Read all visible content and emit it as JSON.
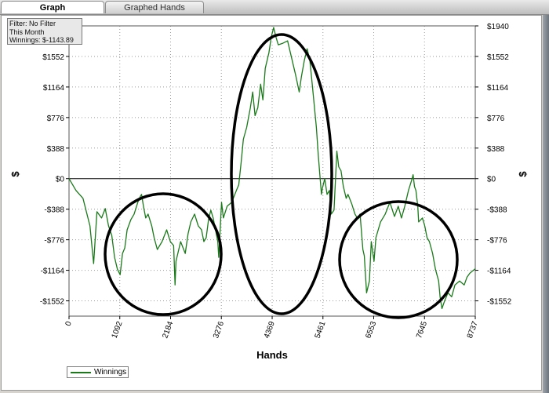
{
  "tabs": [
    {
      "label": "Graph",
      "active": true
    },
    {
      "label": "Graphed Hands",
      "active": false
    }
  ],
  "filter": {
    "line1": "Filter: No Filter",
    "line2": "This Month",
    "line3": "Winnings: $-1143.89"
  },
  "chart_data": {
    "type": "line",
    "xlabel": "Hands",
    "ylabel": "$",
    "xlim": [
      0,
      8737
    ],
    "ylim": [
      -1746,
      1940
    ],
    "x_ticks": [
      "0",
      "1092",
      "2184",
      "3276",
      "4369",
      "5461",
      "6553",
      "7645",
      "8737"
    ],
    "y_ticks_left": [
      "$1552",
      "$1164",
      "$776",
      "$388",
      "$0",
      "-$388",
      "-$776",
      "-$1164",
      "-$1552"
    ],
    "y_ticks_right": [
      "$1940",
      "$1552",
      "$1164",
      "$776",
      "$388",
      "$0",
      "-$388",
      "-$776",
      "-$1164",
      "-$1552"
    ],
    "grid": true,
    "legend_position": "bottom-left",
    "series": [
      {
        "name": "Winnings",
        "color": "#1a7a1a",
        "points": [
          [
            0,
            0
          ],
          [
            150,
            -150
          ],
          [
            300,
            -250
          ],
          [
            450,
            -600
          ],
          [
            530,
            -1080
          ],
          [
            600,
            -420
          ],
          [
            700,
            -500
          ],
          [
            780,
            -380
          ],
          [
            850,
            -600
          ],
          [
            920,
            -720
          ],
          [
            980,
            -1000
          ],
          [
            1040,
            -1150
          ],
          [
            1100,
            -1220
          ],
          [
            1150,
            -950
          ],
          [
            1200,
            -880
          ],
          [
            1250,
            -650
          ],
          [
            1330,
            -520
          ],
          [
            1400,
            -450
          ],
          [
            1480,
            -300
          ],
          [
            1530,
            -230
          ],
          [
            1560,
            -200
          ],
          [
            1600,
            -350
          ],
          [
            1650,
            -500
          ],
          [
            1700,
            -450
          ],
          [
            1780,
            -600
          ],
          [
            1830,
            -750
          ],
          [
            1900,
            -900
          ],
          [
            2000,
            -800
          ],
          [
            2100,
            -650
          ],
          [
            2180,
            -800
          ],
          [
            2250,
            -850
          ],
          [
            2280,
            -1350
          ],
          [
            2300,
            -1050
          ],
          [
            2400,
            -800
          ],
          [
            2500,
            -950
          ],
          [
            2560,
            -700
          ],
          [
            2620,
            -550
          ],
          [
            2700,
            -450
          ],
          [
            2780,
            -600
          ],
          [
            2850,
            -650
          ],
          [
            2900,
            -800
          ],
          [
            2950,
            -750
          ],
          [
            3000,
            -520
          ],
          [
            3050,
            -400
          ],
          [
            3100,
            -500
          ],
          [
            3150,
            -650
          ],
          [
            3200,
            -800
          ],
          [
            3220,
            -1000
          ],
          [
            3280,
            -300
          ],
          [
            3320,
            -500
          ],
          [
            3400,
            -350
          ],
          [
            3500,
            -300
          ],
          [
            3600,
            -150
          ],
          [
            3650,
            -80
          ],
          [
            3700,
            200
          ],
          [
            3750,
            500
          ],
          [
            3820,
            650
          ],
          [
            3900,
            900
          ],
          [
            3950,
            1100
          ],
          [
            4000,
            800
          ],
          [
            4060,
            900
          ],
          [
            4120,
            1200
          ],
          [
            4170,
            1000
          ],
          [
            4220,
            1400
          ],
          [
            4300,
            1600
          ],
          [
            4350,
            1800
          ],
          [
            4400,
            1920
          ],
          [
            4450,
            1800
          ],
          [
            4500,
            1700
          ],
          [
            4600,
            1720
          ],
          [
            4700,
            1750
          ],
          [
            4800,
            1500
          ],
          [
            4880,
            1300
          ],
          [
            4950,
            1100
          ],
          [
            5000,
            1300
          ],
          [
            5060,
            1500
          ],
          [
            5120,
            1650
          ],
          [
            5180,
            1500
          ],
          [
            5230,
            1200
          ],
          [
            5280,
            900
          ],
          [
            5320,
            650
          ],
          [
            5360,
            300
          ],
          [
            5400,
            0
          ],
          [
            5430,
            -200
          ],
          [
            5450,
            -120
          ],
          [
            5500,
            0
          ],
          [
            5550,
            -200
          ],
          [
            5600,
            -150
          ],
          [
            5640,
            -450
          ],
          [
            5700,
            -400
          ],
          [
            5760,
            350
          ],
          [
            5800,
            150
          ],
          [
            5850,
            100
          ],
          [
            5900,
            -100
          ],
          [
            5960,
            -250
          ],
          [
            6000,
            -200
          ],
          [
            6080,
            -320
          ],
          [
            6150,
            -450
          ],
          [
            6200,
            -500
          ],
          [
            6260,
            -450
          ],
          [
            6300,
            -750
          ],
          [
            6320,
            -900
          ],
          [
            6350,
            -980
          ],
          [
            6400,
            -1450
          ],
          [
            6460,
            -1300
          ],
          [
            6500,
            -800
          ],
          [
            6560,
            -1050
          ],
          [
            6600,
            -750
          ],
          [
            6700,
            -550
          ],
          [
            6800,
            -450
          ],
          [
            6900,
            -300
          ],
          [
            7000,
            -480
          ],
          [
            7080,
            -350
          ],
          [
            7150,
            -500
          ],
          [
            7220,
            -350
          ],
          [
            7300,
            -150
          ],
          [
            7380,
            0
          ],
          [
            7400,
            50
          ],
          [
            7430,
            -100
          ],
          [
            7460,
            -150
          ],
          [
            7500,
            -350
          ],
          [
            7520,
            -550
          ],
          [
            7600,
            -500
          ],
          [
            7650,
            -600
          ],
          [
            7700,
            -750
          ],
          [
            7750,
            -800
          ],
          [
            7820,
            -950
          ],
          [
            7880,
            -1150
          ],
          [
            7950,
            -1300
          ],
          [
            7980,
            -1500
          ],
          [
            8020,
            -1650
          ],
          [
            8080,
            -1550
          ],
          [
            8150,
            -1450
          ],
          [
            8230,
            -1500
          ],
          [
            8300,
            -1350
          ],
          [
            8400,
            -1300
          ],
          [
            8500,
            -1350
          ],
          [
            8560,
            -1250
          ],
          [
            8620,
            -1200
          ],
          [
            8737,
            -1143.89
          ]
        ]
      }
    ]
  }
}
